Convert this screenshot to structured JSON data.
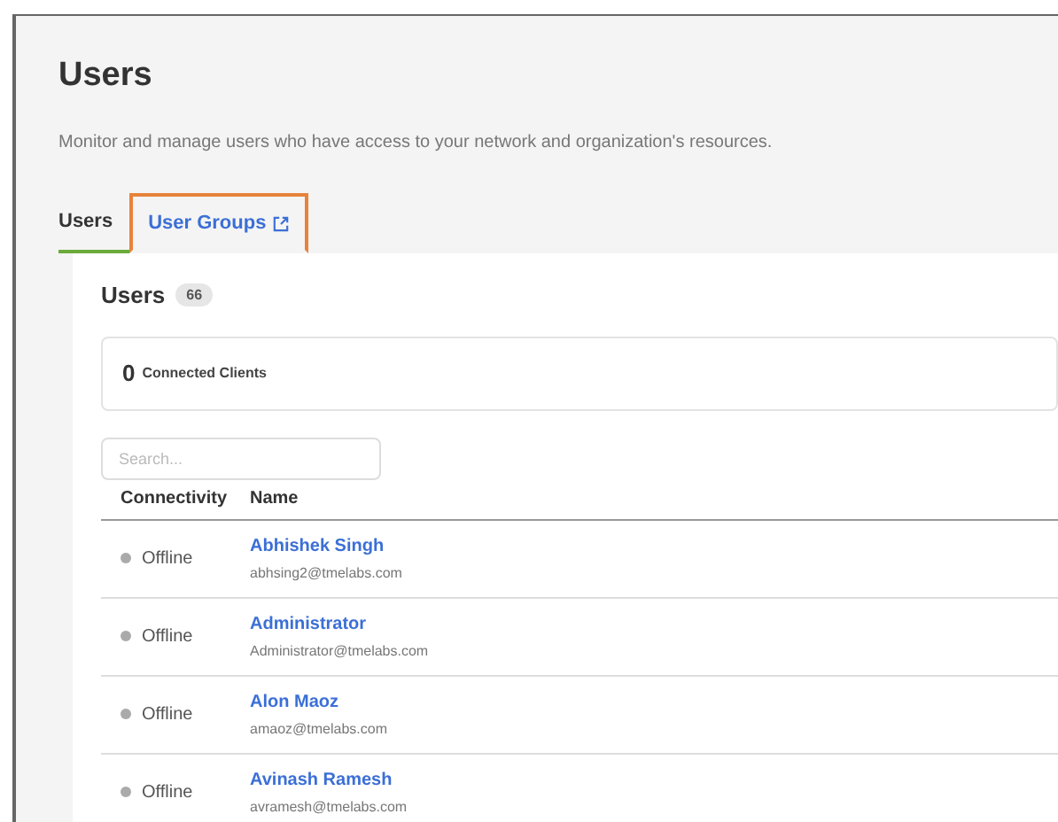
{
  "page": {
    "title": "Users",
    "description": "Monitor and manage users who have access to your network and organization's resources."
  },
  "tabs": [
    {
      "label": "Users",
      "selected": true,
      "external": false,
      "highlighted": false
    },
    {
      "label": "User Groups",
      "selected": false,
      "external": true,
      "highlighted": true
    }
  ],
  "card": {
    "title": "Users",
    "count": "66",
    "connected": {
      "value": "0",
      "label": "Connected Clients"
    },
    "search": {
      "placeholder": "Search..."
    },
    "table": {
      "columns": [
        "Connectivity",
        "Name"
      ],
      "rows": [
        {
          "status": "Offline",
          "name": "Abhishek Singh",
          "email": "abhsing2@tmelabs.com"
        },
        {
          "status": "Offline",
          "name": "Administrator",
          "email": "Administrator@tmelabs.com"
        },
        {
          "status": "Offline",
          "name": "Alon Maoz",
          "email": "amaoz@tmelabs.com"
        },
        {
          "status": "Offline",
          "name": "Avinash Ramesh",
          "email": "avramesh@tmelabs.com"
        }
      ]
    }
  }
}
